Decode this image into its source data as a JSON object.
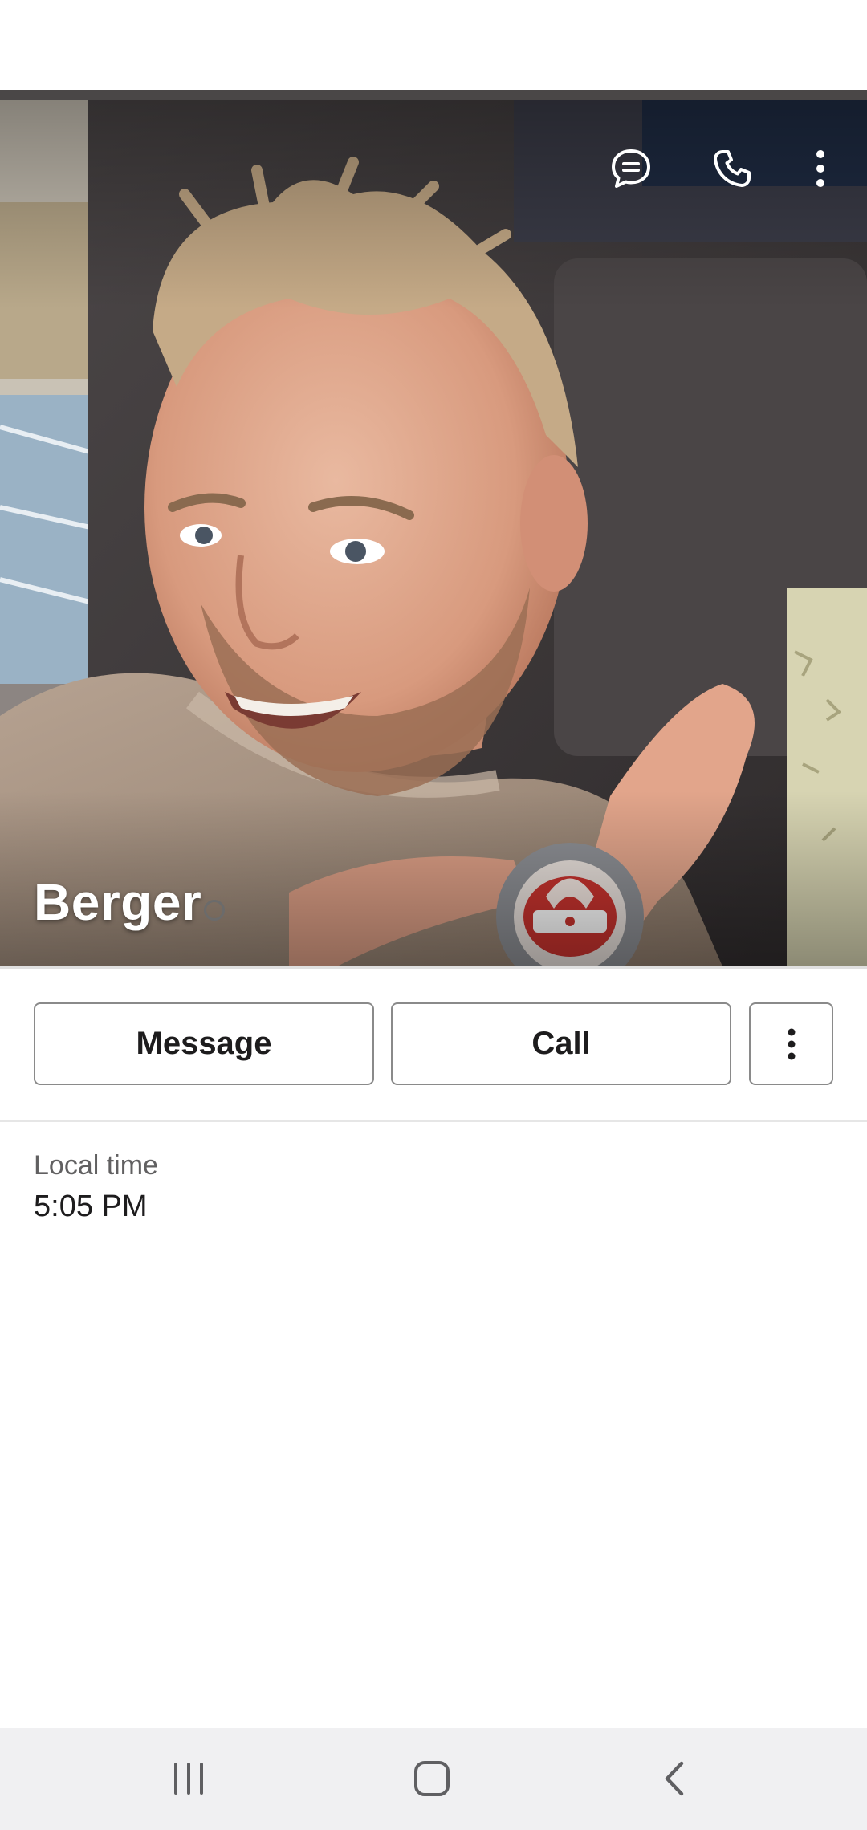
{
  "profile": {
    "name": "Berger",
    "presence": "away"
  },
  "hero_actions": {
    "message_icon": "message-bubble-icon",
    "call_icon": "phone-icon",
    "more_icon": "kebab-menu-icon"
  },
  "actions": {
    "message_label": "Message",
    "call_label": "Call",
    "more_icon": "kebab-menu-icon"
  },
  "details": {
    "local_time_label": "Local time",
    "local_time_value": "5:05 PM"
  },
  "system_nav": {
    "recents_icon": "recent-apps-icon",
    "home_icon": "home-icon",
    "back_icon": "back-chevron-icon"
  },
  "colors": {
    "text_primary": "#1d1c1d",
    "text_secondary": "#616061",
    "button_border": "#8a8a8a",
    "nav_bar": "#f0f0f2"
  }
}
